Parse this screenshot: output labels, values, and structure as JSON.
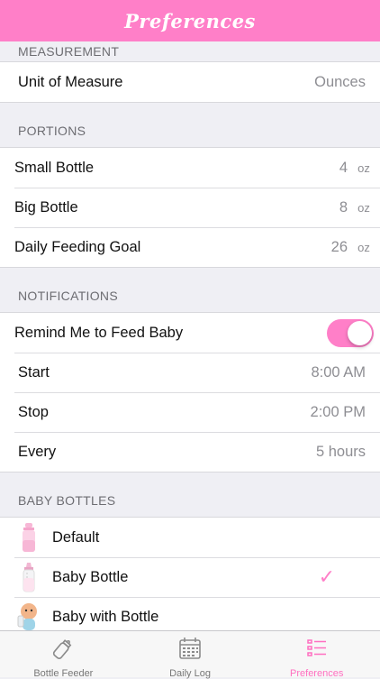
{
  "header": {
    "title": "Preferences"
  },
  "measurement": {
    "header": "MEASUREMENT",
    "unit_label": "Unit of Measure",
    "unit_value": "Ounces"
  },
  "portions": {
    "header": "PORTIONS",
    "small_label": "Small Bottle",
    "small_value": "4",
    "small_unit": "oz",
    "big_label": "Big Bottle",
    "big_value": "8",
    "big_unit": "oz",
    "goal_label": "Daily Feeding Goal",
    "goal_value": "26",
    "goal_unit": "oz"
  },
  "notifications": {
    "header": "NOTIFICATIONS",
    "remind_label": "Remind Me to Feed Baby",
    "remind_on": true,
    "start_label": "Start",
    "start_value": "8:00 AM",
    "stop_label": "Stop",
    "stop_value": "2:00 PM",
    "every_label": "Every",
    "every_value": "5 hours"
  },
  "bottles": {
    "header": "BABY BOTTLES",
    "items": [
      {
        "label": "Default",
        "icon": "pink-bottle-icon",
        "selected": false
      },
      {
        "label": "Baby Bottle",
        "icon": "baby-bottle-icon",
        "selected": true
      },
      {
        "label": "Baby with Bottle",
        "icon": "baby-with-bottle-icon",
        "selected": false
      }
    ]
  },
  "tabbar": {
    "tabs": [
      {
        "label": "Bottle Feeder",
        "icon": "bottle-icon",
        "active": false
      },
      {
        "label": "Daily Log",
        "icon": "calendar-icon",
        "active": false
      },
      {
        "label": "Preferences",
        "icon": "list-icon",
        "active": true
      }
    ]
  },
  "colors": {
    "accent": "#ff7fc8",
    "background": "#efeff4"
  }
}
